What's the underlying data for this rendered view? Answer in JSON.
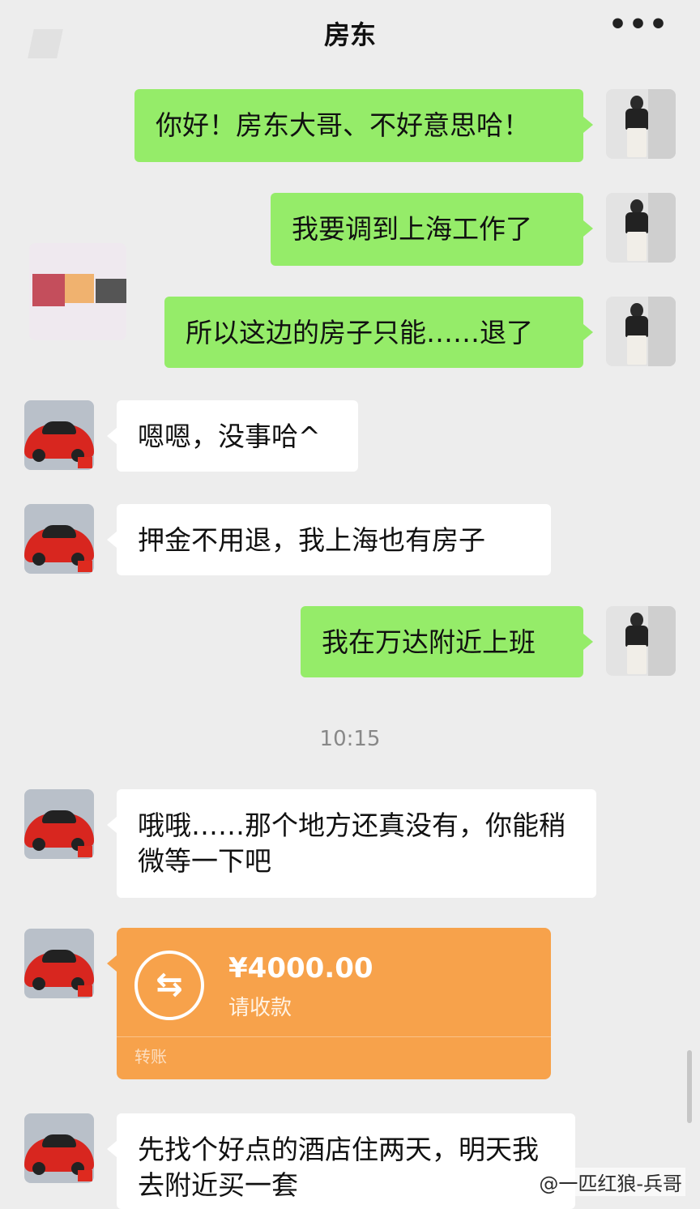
{
  "header": {
    "title": "房东",
    "more_label": "•••"
  },
  "messages": [
    {
      "sender": "me",
      "text": "你好！房东大哥、不好意思哈！"
    },
    {
      "sender": "me",
      "text": "我要调到上海工作了"
    },
    {
      "sender": "me",
      "text": "所以这边的房子只能……退了"
    },
    {
      "sender": "landlord",
      "text": "嗯嗯，没事哈^"
    },
    {
      "sender": "landlord",
      "text": "押金不用退，我上海也有房子"
    },
    {
      "sender": "me",
      "text": "我在万达附近上班"
    },
    {
      "sender": "landlord",
      "text": "哦哦……那个地方还真没有，你能稍微等一下吧"
    },
    {
      "sender": "landlord",
      "text": "先找个好点的酒店住两天，明天我去附近买一套"
    }
  ],
  "timestamp": "10:15",
  "transfer": {
    "amount": "¥4000.00",
    "status": "请收款",
    "footer": "转账",
    "icon": "⇆"
  },
  "watermark": "@一匹红狼-兵哥"
}
